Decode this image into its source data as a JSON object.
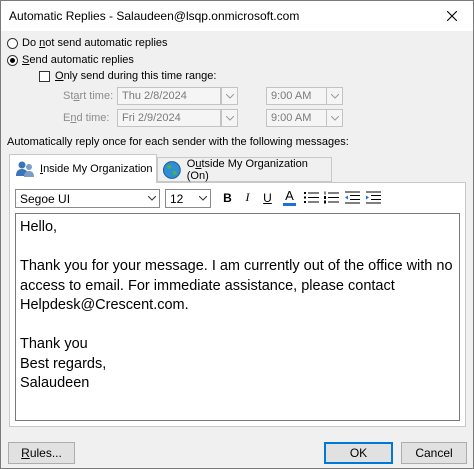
{
  "window": {
    "title": "Automatic Replies - Salaudeen@lsqp.onmicrosoft.com"
  },
  "options": {
    "do_not_send_pre": "Do ",
    "do_not_send_u": "n",
    "do_not_send_post": "ot send automatic replies",
    "send_u": "S",
    "send_post": "end automatic replies",
    "send_selected": true,
    "only_time_range_u": "O",
    "only_time_range_post": "nly send during this time range:",
    "only_time_range_checked": false
  },
  "time_range": {
    "start_label_pre": "St",
    "start_label_u": "a",
    "start_label_post": "rt time:",
    "start_date": "Thu 2/8/2024",
    "start_time": "9:00 AM",
    "end_label_pre": "E",
    "end_label_u": "n",
    "end_label_post": "d time:",
    "end_date": "Fri 2/9/2024",
    "end_time": "9:00 AM"
  },
  "section_label": "Automatically reply once for each sender with the following messages:",
  "tabs": [
    {
      "label_pre": "",
      "label_u": "I",
      "label_post": "nside My Organization",
      "active": true
    },
    {
      "label_pre": "O",
      "label_u": "u",
      "label_post": "tside My Organization (On)",
      "active": false
    }
  ],
  "toolbar": {
    "font": "Segoe UI",
    "size": "12",
    "bold": "B",
    "italic": "I",
    "underline": "U",
    "font_color": "A",
    "font_color_accent": "#1e6fd9"
  },
  "message": {
    "line1": "Hello,",
    "line2": "Thank you for your message. I am currently out of the office with no access to email. For immediate assistance, please contact Helpdesk@Crescent.com.",
    "line3": "Thank you",
    "line4": "Best regards,",
    "line5": "Salaudeen"
  },
  "buttons": {
    "rules_u": "R",
    "rules_post": "ules...",
    "ok": "OK",
    "cancel": "Cancel"
  },
  "icons": {
    "close": "close-icon",
    "chevron": "chevron-down-icon",
    "inside_org": "people-icon",
    "outside_org": "globe-icon"
  }
}
